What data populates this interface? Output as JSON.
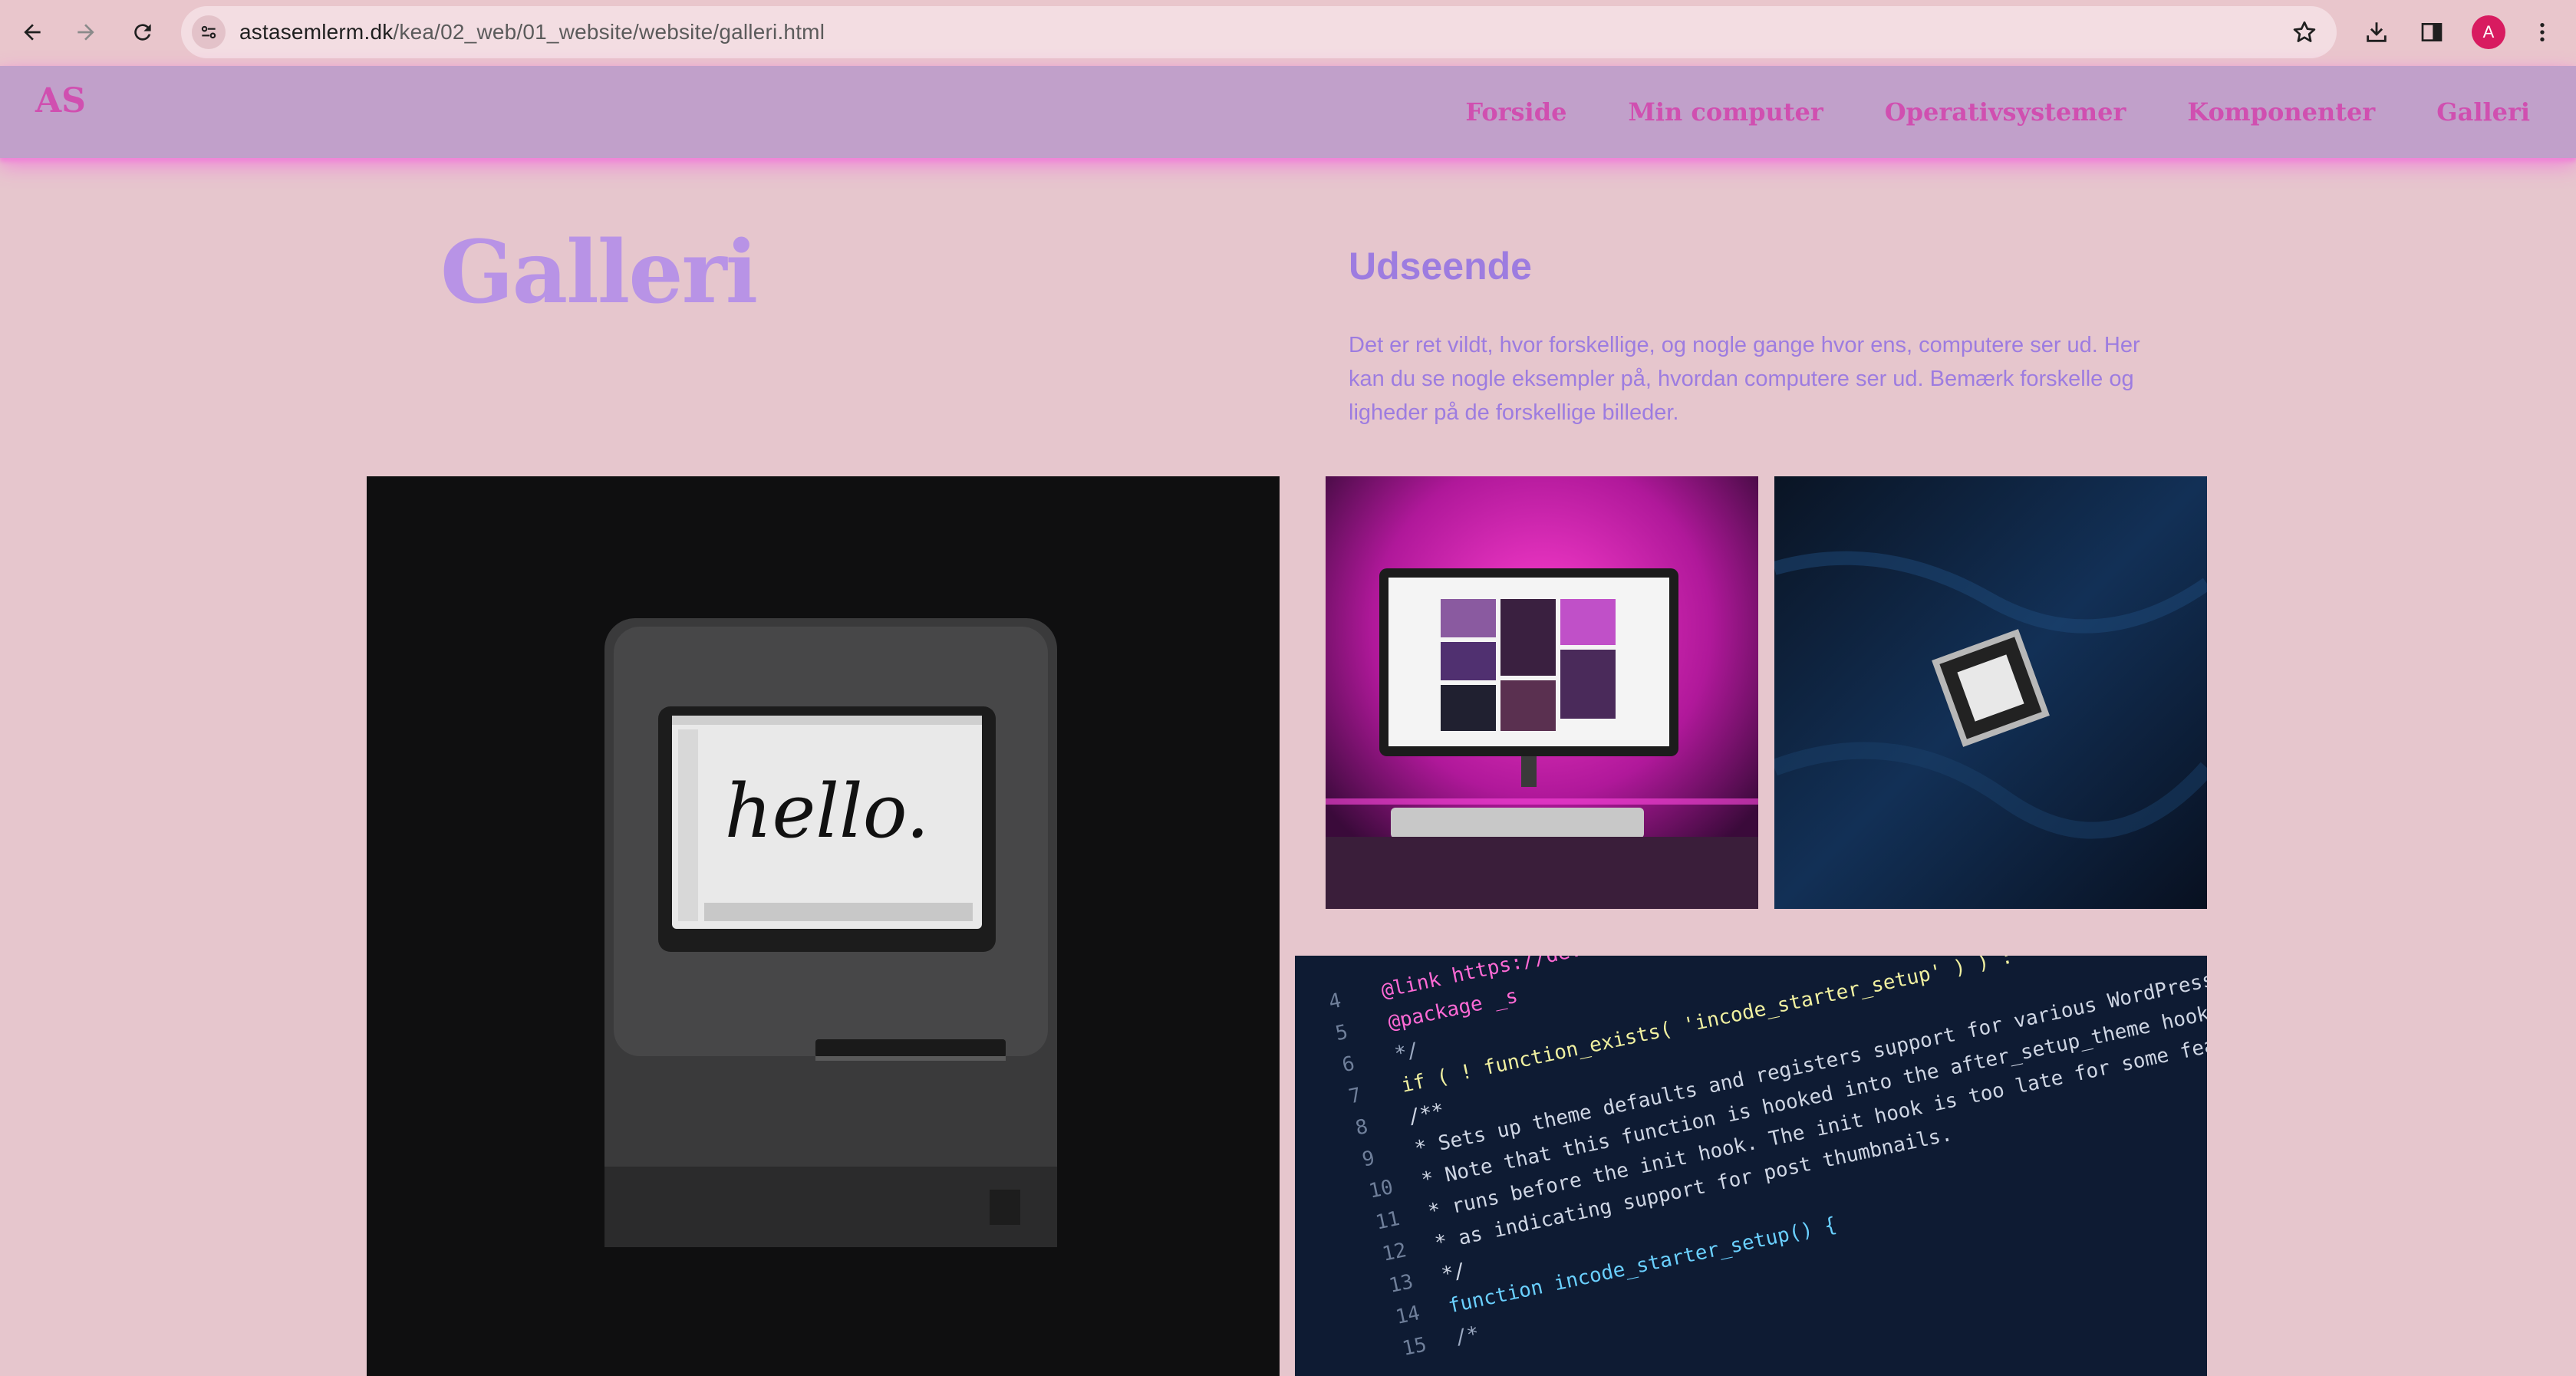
{
  "browser": {
    "url_domain": "astasemlerm.dk",
    "url_path": "/kea/02_web/01_website/website/galleri.html",
    "avatar_letter": "A"
  },
  "site": {
    "logo": "AS",
    "nav": [
      {
        "label": "Forside"
      },
      {
        "label": "Min computer"
      },
      {
        "label": "Operativsystemer"
      },
      {
        "label": "Komponenter"
      },
      {
        "label": "Galleri"
      }
    ]
  },
  "main": {
    "title": "Galleri",
    "section_title": "Udseende",
    "section_text": "Det er ret vildt, hvor forskellige, og nogle gange hvor ens, computere ser ud. Her kan du se nogle eksempler på, hvordan computere ser ud. Bemærk forskelle og ligheder på de forskellige billeder."
  },
  "gallery": {
    "mac_screen_text": "hello.",
    "code_lines": [
      "@link https://devel",
      "@package _s",
      "*/",
      "if ( ! function_exists( 'incode_starter_setup' ) ) :",
      "/**",
      " * Sets up theme defaults and registers support for various WordPress features.",
      " * Note that this function is hooked into the after_setup_theme hook, which",
      " * runs before the init hook. The init hook is too late for some features, such",
      " * as indicating support for post thumbnails.",
      " */",
      "function incode_starter_setup() {",
      "  /*"
    ],
    "code_line_numbers": [
      "4",
      "5",
      "6",
      "7",
      "8",
      "9",
      "10",
      "11",
      "12",
      "13",
      "14",
      "15"
    ]
  },
  "colors": {
    "page_bg": "#e6c6cd",
    "header_bg": "#c1a0ca",
    "header_glow": "#f088d8",
    "accent_pink": "#d04fb0",
    "accent_purple": "#9d7ce0"
  }
}
